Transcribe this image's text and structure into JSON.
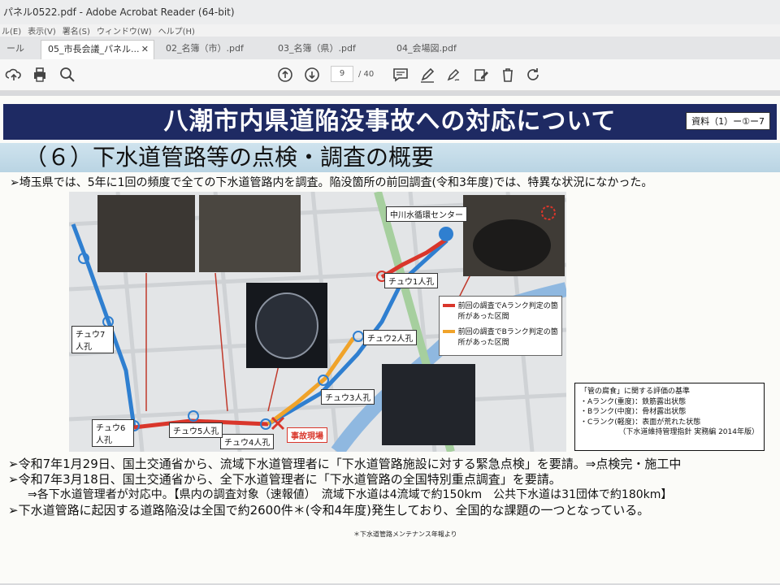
{
  "window": {
    "title": "パネル0522.pdf - Adobe Acrobat Reader (64-bit)",
    "menu": [
      "ル(E)",
      "表示(V)",
      "署名(S)",
      "ウィンドウ(W)",
      "ヘルプ(H)"
    ]
  },
  "tabs": [
    {
      "label": "ール"
    },
    {
      "label": "05_市長会議_パネル...",
      "active": true
    },
    {
      "label": "02_名簿（市）.pdf"
    },
    {
      "label": "03_名簿（県）.pdf"
    },
    {
      "label": "04_会場図.pdf"
    }
  ],
  "toolbar": {
    "page_current": "9",
    "page_total": "/ 40",
    "icons": [
      "cloud-upload-icon",
      "print-icon",
      "zoom-icon",
      "page-up-icon",
      "page-down-icon",
      "comment-icon",
      "highlight-icon",
      "sign-icon",
      "edit-icon",
      "delete-icon",
      "rotate-icon"
    ]
  },
  "slide": {
    "title": "八潮市内県道陥没事故への対応について",
    "ref": "資料（1）ー①ー7",
    "section": "（６）下水道管路等の点検・調査の概要",
    "lead": "➢埼玉県では、5年に1回の頻度で全ての下水道管路内を調査。陥没箇所の前回調査(令和3年度)では、特異な状況になかった。",
    "map_labels": {
      "center": "中川水循環センター",
      "manholes": [
        "チュウ1人孔",
        "チュウ2人孔",
        "チュウ3人孔",
        "チュウ4人孔",
        "チュウ5人孔",
        "チュウ6人孔",
        "チュウ7人孔"
      ],
      "accident": "事故現場",
      "legend_a": "前回の調査でAランク判定の箇所があった区間",
      "legend_b": "前回の調査でBランク判定の箇所があった区間"
    },
    "criteria": {
      "title": "「管の腐食」に関する評価の基準",
      "items": [
        "・Aランク(重度)：鉄筋露出状態",
        "・Bランク(中度)：骨材露出状態",
        "・Cランク(軽度)：表面が荒れた状態"
      ],
      "source": "（下水道維持管理指針 実務編 2014年版）"
    },
    "bullets": [
      "➢令和7年1月29日、国土交通省から、流域下水道管理者に「下水道管路施設に対する緊急点検」を要請。⇒点検完・施工中",
      "➢令和7年3月18日、国土交通省から、全下水道管理者に「下水道管路の全国特別重点調査」を要請。",
      "⇒各下水道管理者が対応中。【県内の調査対象（速報値）　流域下水道は4流域で約150km　公共下水道は31団体で約180km】",
      "➢下水道管路に起因する道路陥没は全国で約2600件＊(令和4年度)発生しており、全国的な課題の一つとなっている。"
    ],
    "footnote": "＊下水道管路メンテナンス年報より"
  },
  "colors": {
    "title_bg": "#1e2a63",
    "route_red": "#d9362b",
    "route_blue": "#2f7fd0",
    "route_orange": "#f0a32a"
  }
}
